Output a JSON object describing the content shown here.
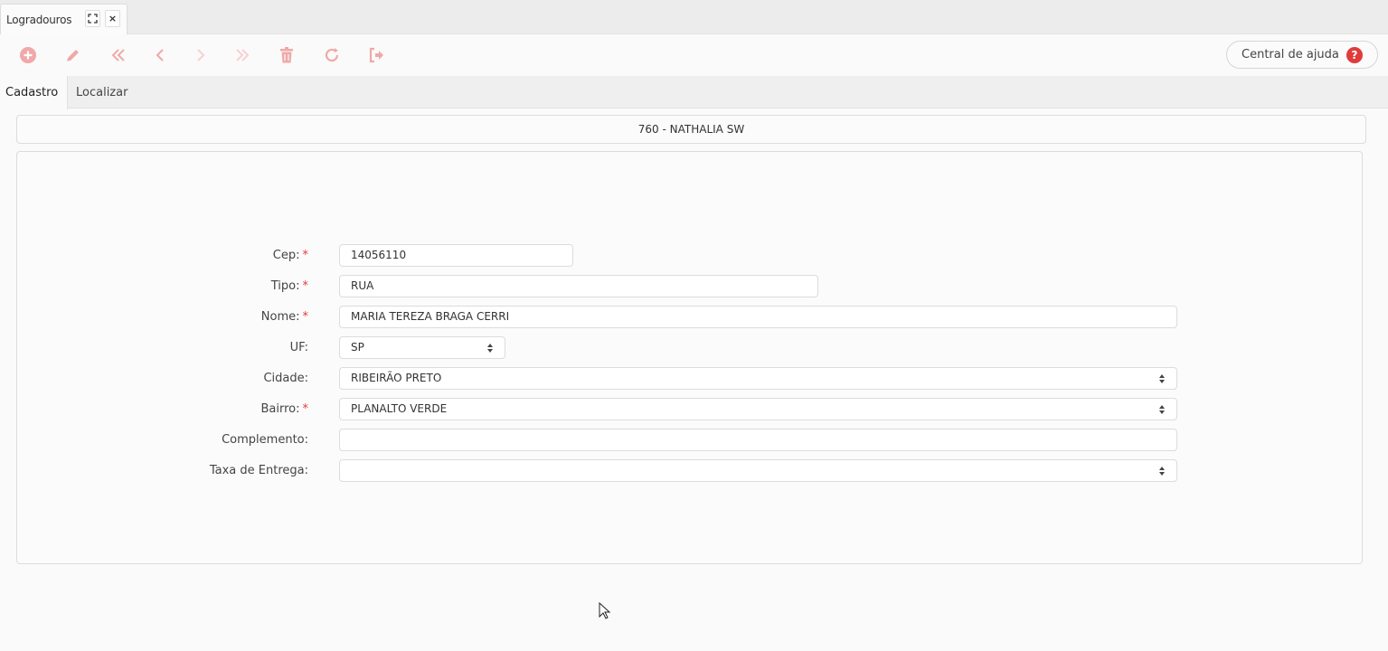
{
  "window_tab": {
    "title": "Logradouros",
    "expand_icon": "expand-icon",
    "close_label": "×"
  },
  "toolbar": {
    "icons": [
      "add-icon",
      "edit-icon",
      "first-icon",
      "previous-icon",
      "next-icon",
      "last-icon",
      "delete-icon",
      "refresh-icon",
      "exit-icon"
    ],
    "help_label": "Central de ajuda",
    "help_glyph": "?"
  },
  "form_tabs": [
    "Cadastro",
    "Localizar"
  ],
  "header": {
    "title": "760 - NATHALIA SW"
  },
  "form": {
    "cep": {
      "label": "Cep:",
      "required": "*",
      "value": "14056110"
    },
    "tipo": {
      "label": "Tipo:",
      "required": "*",
      "value": "RUA"
    },
    "nome": {
      "label": "Nome:",
      "required": "*",
      "value": "MARIA TEREZA BRAGA CERRI"
    },
    "uf": {
      "label": "UF:",
      "value": "SP"
    },
    "cidade": {
      "label": "Cidade:",
      "value": "RIBEIRÃO PRETO"
    },
    "bairro": {
      "label": "Bairro:",
      "required": "*",
      "value": "PLANALTO VERDE"
    },
    "complemento": {
      "label": "Complemento:",
      "value": ""
    },
    "taxa": {
      "label": "Taxa de Entrega:",
      "value": ""
    }
  },
  "colors": {
    "accent": "#e03b3b",
    "toolbar_icon": "#f0a8a8"
  }
}
